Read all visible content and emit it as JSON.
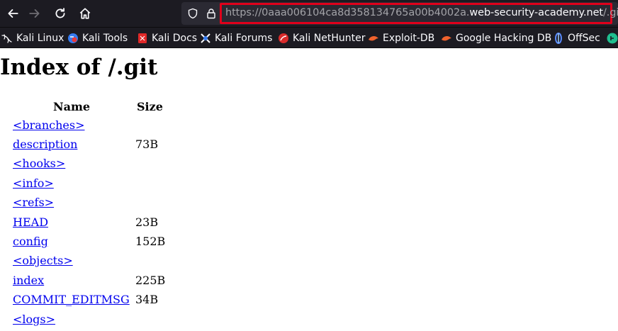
{
  "browser": {
    "url_prefix": "https://0aaa006104ca8d358134765a00b4002a.",
    "url_domain": "web-security-academy.net",
    "url_suffix": "/.git",
    "highlight_color": "#e0001b",
    "icons": [
      "back-arrow-icon",
      "forward-arrow-icon",
      "reload-icon",
      "home-icon",
      "shield-icon",
      "lock-icon"
    ]
  },
  "bookmarks": [
    {
      "label": "Kali Linux",
      "icon": "kali-dragon-icon"
    },
    {
      "label": "Kali Tools",
      "icon": "kali-tools-icon"
    },
    {
      "label": "Kali Docs",
      "icon": "kali-docs-icon"
    },
    {
      "label": "Kali Forums",
      "icon": "kali-forums-icon"
    },
    {
      "label": "Kali NetHunter",
      "icon": "nethunter-icon"
    },
    {
      "label": "Exploit-DB",
      "icon": "exploit-db-icon"
    },
    {
      "label": "Google Hacking DB",
      "icon": "ghdb-icon"
    },
    {
      "label": "OffSec",
      "icon": "offsec-icon"
    }
  ],
  "page": {
    "title": "Index of /.git",
    "columns": {
      "name": "Name",
      "size": "Size"
    },
    "rows": [
      {
        "name": "<branches>",
        "size": ""
      },
      {
        "name": "description",
        "size": "73B"
      },
      {
        "name": "<hooks>",
        "size": ""
      },
      {
        "name": "<info>",
        "size": ""
      },
      {
        "name": "<refs>",
        "size": ""
      },
      {
        "name": "HEAD",
        "size": "23B"
      },
      {
        "name": "config",
        "size": "152B"
      },
      {
        "name": "<objects>",
        "size": ""
      },
      {
        "name": "index",
        "size": "225B"
      },
      {
        "name": "COMMIT_EDITMSG",
        "size": "34B"
      },
      {
        "name": "<logs>",
        "size": ""
      }
    ]
  }
}
